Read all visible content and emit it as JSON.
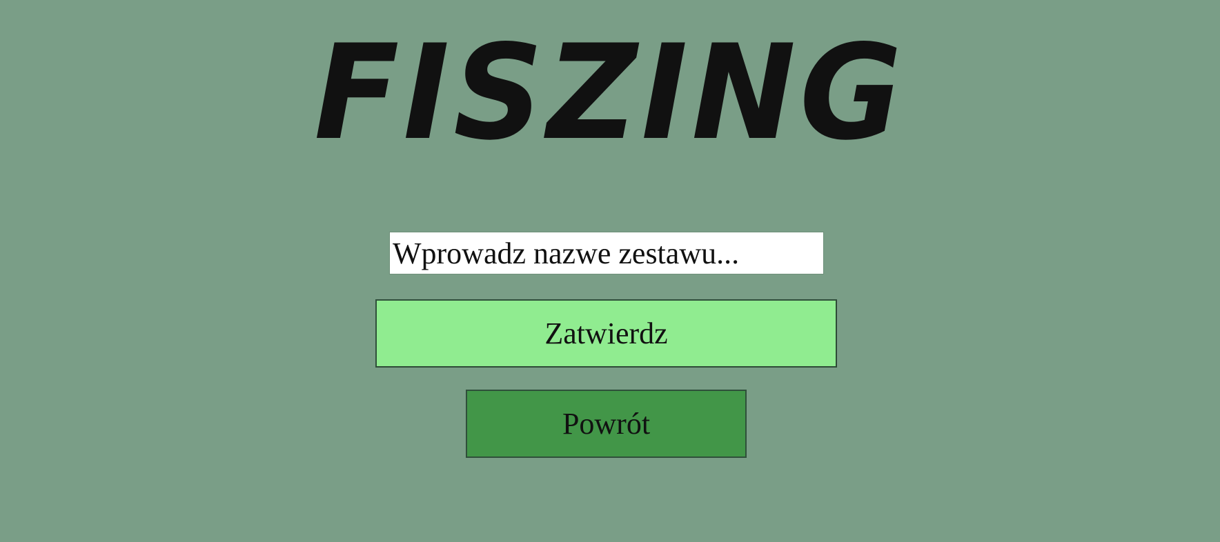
{
  "app": {
    "logo_text": "FISZING"
  },
  "form": {
    "name_input_placeholder": "Wprowadz nazwe zestawu...",
    "name_input_value": ""
  },
  "buttons": {
    "confirm_label": "Zatwierdz",
    "back_label": "Powrót"
  },
  "colors": {
    "background": "#7a9e87",
    "confirm_button": "#90ec90",
    "back_button": "#429648",
    "input_background": "#ffffff",
    "text": "#111111"
  }
}
